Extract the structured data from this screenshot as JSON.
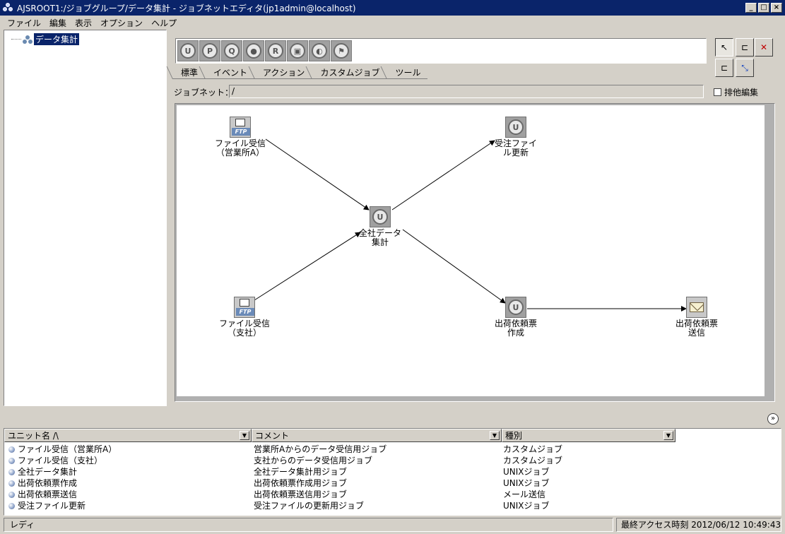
{
  "window": {
    "title": "AJSROOT1:/ジョブグループ/データ集計 - ジョブネットエディタ(jp1admin@localhost)",
    "buttons": [
      "_",
      "□",
      "×"
    ]
  },
  "menu": [
    "ファイル",
    "編集",
    "表示",
    "オプション",
    "ヘルプ"
  ],
  "tree": {
    "item_label": "データ集計",
    "item_icon": "jobnet-icon"
  },
  "toolbar": {
    "icons": [
      {
        "name": "unix-job-icon",
        "glyph": "U"
      },
      {
        "name": "pc-job-icon",
        "glyph": "P"
      },
      {
        "name": "qs-job-icon",
        "glyph": "Q"
      },
      {
        "name": "nested-jobnet-icon",
        "glyph": "●"
      },
      {
        "name": "remote-jobnet-icon",
        "glyph": "R"
      },
      {
        "name": "manager-jobnet-icon",
        "glyph": "▣"
      },
      {
        "name": "judgment-job-icon",
        "glyph": "◐"
      },
      {
        "name": "release-flag-icon",
        "glyph": "⚑"
      }
    ]
  },
  "tabs": [
    "標準",
    "イベント",
    "アクション",
    "カスタムジョブ",
    "ツール"
  ],
  "active_tab": "標準",
  "right_tools": [
    {
      "name": "select-pointer-icon",
      "glyph": "↖"
    },
    {
      "name": "connect-relation-icon",
      "glyph": "⊏"
    },
    {
      "name": "delete-relation-icon",
      "glyph": "✕"
    },
    {
      "name": "connect-condition-icon",
      "glyph": "⊏"
    },
    {
      "name": "connect-branch-icon",
      "glyph": "⤡"
    }
  ],
  "jobnet": {
    "label": "ジョブネット：",
    "value": "/"
  },
  "exclusive_edit": {
    "label": "排他編集",
    "checked": false
  },
  "nodes": {
    "recv_a": {
      "label": "ファイル受信\n（営業所A）",
      "icon": "ftp-icon",
      "glyph": "FTP"
    },
    "recv_hq": {
      "label": "ファイル受信\n（支社）",
      "icon": "ftp-icon",
      "glyph": "FTP"
    },
    "aggregate": {
      "label": "全社データ\n集計",
      "icon": "unix-job-icon",
      "glyph": "U"
    },
    "update_orders": {
      "label": "受注ファイ\nル更新",
      "icon": "unix-job-icon",
      "glyph": "U"
    },
    "create_slip": {
      "label": "出荷依頼票\n作成",
      "icon": "unix-job-icon",
      "glyph": "U"
    },
    "send_slip": {
      "label": "出荷依頼票\n送信",
      "icon": "mail-icon",
      "glyph": ""
    }
  },
  "list": {
    "headers": [
      "ユニット名 /\\",
      "コメント",
      "種別"
    ],
    "rows": [
      {
        "name": "ファイル受信（営業所A）",
        "comment": "営業所Aからのデータ受信用ジョブ",
        "type": "カスタムジョブ"
      },
      {
        "name": "ファイル受信（支社）",
        "comment": "支社からのデータ受信用ジョブ",
        "type": "カスタムジョブ"
      },
      {
        "name": "全社データ集計",
        "comment": "全社データ集計用ジョブ",
        "type": "UNIXジョブ"
      },
      {
        "name": "出荷依頼票作成",
        "comment": "出荷依頼票作成用ジョブ",
        "type": "UNIXジョブ"
      },
      {
        "name": "出荷依頼票送信",
        "comment": "出荷依頼票送信用ジョブ",
        "type": "メール送信"
      },
      {
        "name": "受注ファイル更新",
        "comment": "受注ファイルの更新用ジョブ",
        "type": "UNIXジョブ"
      }
    ]
  },
  "status": {
    "left": "レディ",
    "right": "最終アクセス時刻 2012/06/12 10:49:43"
  }
}
